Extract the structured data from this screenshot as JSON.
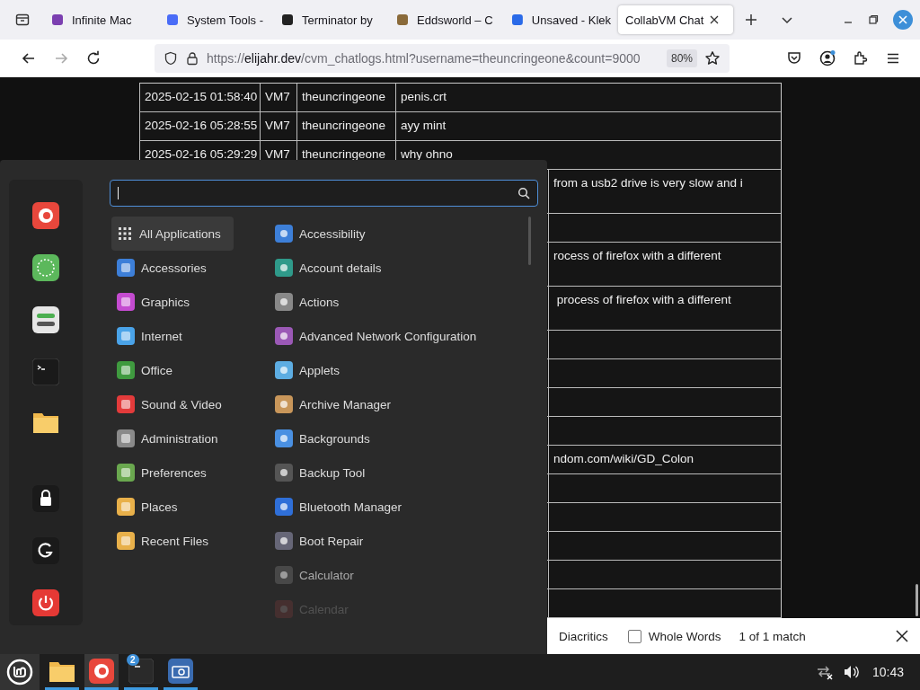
{
  "browser": {
    "tabs": [
      {
        "title": "Infinite Mac",
        "selected": false
      },
      {
        "title": "System Tools -",
        "selected": false
      },
      {
        "title": "Terminator by",
        "selected": false
      },
      {
        "title": "Eddsworld – C",
        "selected": false
      },
      {
        "title": "Unsaved - Klek",
        "selected": false
      },
      {
        "title": "CollabVM Chat",
        "selected": true
      }
    ],
    "forward_disabled": true,
    "url_scheme": "https://",
    "url_domain": "elijahr.dev",
    "url_path": "/cvm_chatlogs.html?username=theuncringeone&count=9000",
    "zoom": "80%"
  },
  "chat_log": {
    "rows": [
      {
        "date": "2025-02-15 01:58:40",
        "vm": "VM7",
        "user": "theuncringeone",
        "message": "penis.crt",
        "tall": false
      },
      {
        "date": "2025-02-16 05:28:55",
        "vm": "VM7",
        "user": "theuncringeone",
        "message": "ayy mint",
        "tall": false
      },
      {
        "date": "2025-02-16 05:29:29",
        "vm": "VM7",
        "user": "theuncringeone",
        "message": "why ohno",
        "tall": false
      },
      {
        "message": "from a usb2 drive is very slow and i",
        "tall": true
      },
      {
        "tall": false
      },
      {
        "message": "rocess of firefox with a different",
        "tall": true
      },
      {
        "message": " process of firefox with a different",
        "tall": true
      },
      {
        "tall": false
      },
      {
        "tall": false
      },
      {
        "tall": false
      },
      {
        "tall": false
      },
      {
        "message": "ndom.com/wiki/GD_Colon",
        "tall": false
      },
      {
        "tall": false
      },
      {
        "tall": false
      },
      {
        "tall": false
      },
      {
        "tall": false
      },
      {
        "tall": false
      }
    ]
  },
  "menu": {
    "categories": [
      {
        "label": "All Applications",
        "selected": true
      },
      {
        "label": "Accessories",
        "selected": false
      },
      {
        "label": "Graphics",
        "selected": false
      },
      {
        "label": "Internet",
        "selected": false
      },
      {
        "label": "Office",
        "selected": false
      },
      {
        "label": "Sound & Video",
        "selected": false
      },
      {
        "label": "Administration",
        "selected": false
      },
      {
        "label": "Preferences",
        "selected": false
      },
      {
        "label": "Places",
        "selected": false
      },
      {
        "label": "Recent Files",
        "selected": false
      }
    ],
    "apps": [
      {
        "label": "Accessibility",
        "dimmed": false,
        "faint": false
      },
      {
        "label": "Account details",
        "dimmed": false,
        "faint": false
      },
      {
        "label": "Actions",
        "dimmed": false,
        "faint": false
      },
      {
        "label": "Advanced Network Configuration",
        "dimmed": false,
        "faint": false
      },
      {
        "label": "Applets",
        "dimmed": false,
        "faint": false
      },
      {
        "label": "Archive Manager",
        "dimmed": false,
        "faint": false
      },
      {
        "label": "Backgrounds",
        "dimmed": false,
        "faint": false
      },
      {
        "label": "Backup Tool",
        "dimmed": false,
        "faint": false
      },
      {
        "label": "Bluetooth Manager",
        "dimmed": false,
        "faint": false
      },
      {
        "label": "Boot Repair",
        "dimmed": false,
        "faint": false
      },
      {
        "label": "Calculator",
        "dimmed": true,
        "faint": false
      },
      {
        "label": "Calendar",
        "dimmed": true,
        "faint": true
      }
    ]
  },
  "find_bar": {
    "diacritics_label": "Diacritics",
    "whole_words": {
      "label": "Whole Words",
      "checked": false
    },
    "result": "1 of 1 match"
  },
  "taskbar": {
    "apps": [
      {
        "active": false
      },
      {
        "active": true
      },
      {
        "active": false,
        "badge": "2"
      },
      {
        "active": false
      }
    ],
    "clock": "10:43"
  }
}
